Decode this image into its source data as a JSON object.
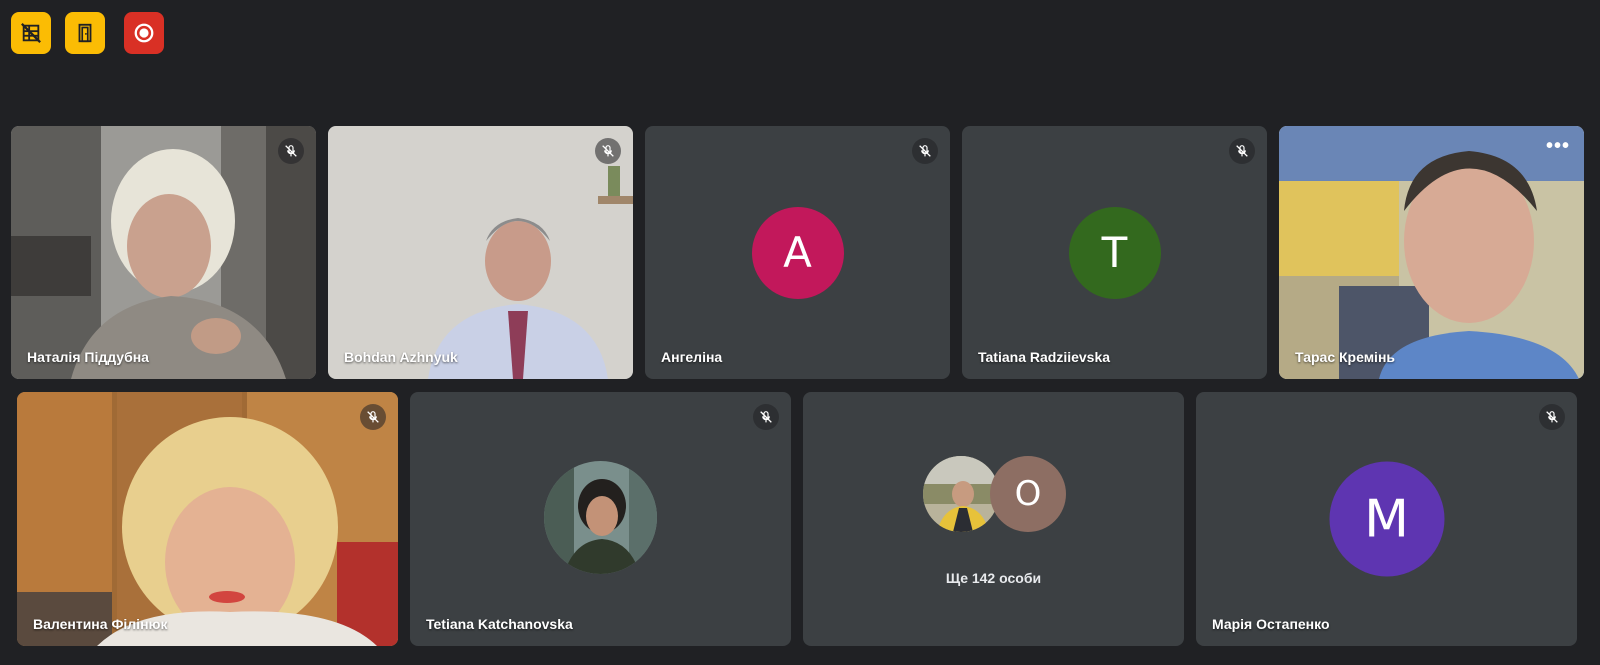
{
  "toolbar": {
    "buttons": [
      {
        "icon": "grid-off-icon",
        "color": "#fbbc04"
      },
      {
        "icon": "door-exit-icon",
        "color": "#fbbc04"
      },
      {
        "icon": "record-icon",
        "color": "#d93025"
      }
    ]
  },
  "participants": [
    {
      "name": "Наталія Піддубна",
      "muted": true,
      "type": "video"
    },
    {
      "name": "Bohdan Azhnyuk",
      "muted": true,
      "type": "video"
    },
    {
      "name": "Ангеліна",
      "muted": true,
      "type": "initial",
      "initial": "А",
      "color": "#c2185b"
    },
    {
      "name": "Tatiana Radziievska",
      "muted": true,
      "type": "initial",
      "initial": "T",
      "color": "#33691e"
    },
    {
      "name": "Тарас Кремінь",
      "muted": false,
      "type": "video",
      "active_speaker": true
    },
    {
      "name": "Валентина Філінюк",
      "muted": true,
      "type": "video"
    },
    {
      "name": "Tetiana Katchanovska",
      "muted": true,
      "type": "photo"
    },
    {
      "name": "Марія Остапенко",
      "muted": true,
      "type": "initial",
      "initial": "M",
      "color": "#5e35b1"
    }
  ],
  "others": {
    "label": "Ще 142 особи",
    "initial": "O",
    "color": "#8d6e63"
  },
  "menu": {
    "more_label": "•••"
  }
}
